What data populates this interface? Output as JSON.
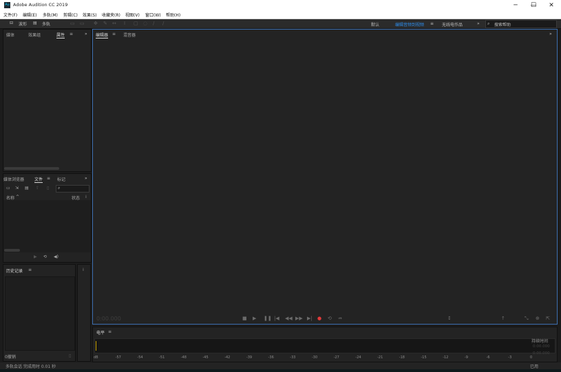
{
  "window": {
    "title": "Adobe Audition CC 2019",
    "icon": "Au"
  },
  "menu": [
    "文件(F)",
    "编辑(E)",
    "多轨(M)",
    "剪辑(C)",
    "效果(S)",
    "收藏夹(R)",
    "视图(V)",
    "窗口(W)",
    "帮助(H)"
  ],
  "toolbar": {
    "waveform": "波形",
    "multitrack": "多轨",
    "workspaces": [
      "默认",
      "编辑音频到视频",
      "无线电作品"
    ],
    "active_workspace": "编辑音频到视频",
    "search_placeholder": "搜索帮助"
  },
  "left_top_panel": {
    "tabs": [
      "媒体",
      "效果组",
      "属性"
    ],
    "active_tab": "属性"
  },
  "files_panel": {
    "tabs": [
      "媒体浏览器",
      "文件",
      "标记"
    ],
    "active_tab": "文件",
    "col_name": "名称",
    "col_status": "状态",
    "search_placeholder": ""
  },
  "history_panel": {
    "title": "历史记录",
    "status": "0撤销"
  },
  "editor": {
    "tabs": [
      "编辑器",
      "混音器"
    ],
    "active_tab": "编辑器",
    "timecode": "0:00.000"
  },
  "level_panel": {
    "title": "电平",
    "ticks": [
      "dB",
      "-57",
      "-54",
      "-51",
      "-48",
      "-45",
      "-42",
      "-39",
      "-36",
      "-33",
      "-30",
      "-27",
      "-24",
      "-21",
      "-18",
      "-15",
      "-12",
      "-9",
      "-6",
      "-3",
      "0"
    ]
  },
  "right_status": {
    "label": "持续时间",
    "v1": "0:00.000",
    "v2": "0:00.000"
  },
  "status_bar": {
    "message": "多轨会话 完成用时 0.01 秒",
    "right": "已用"
  }
}
